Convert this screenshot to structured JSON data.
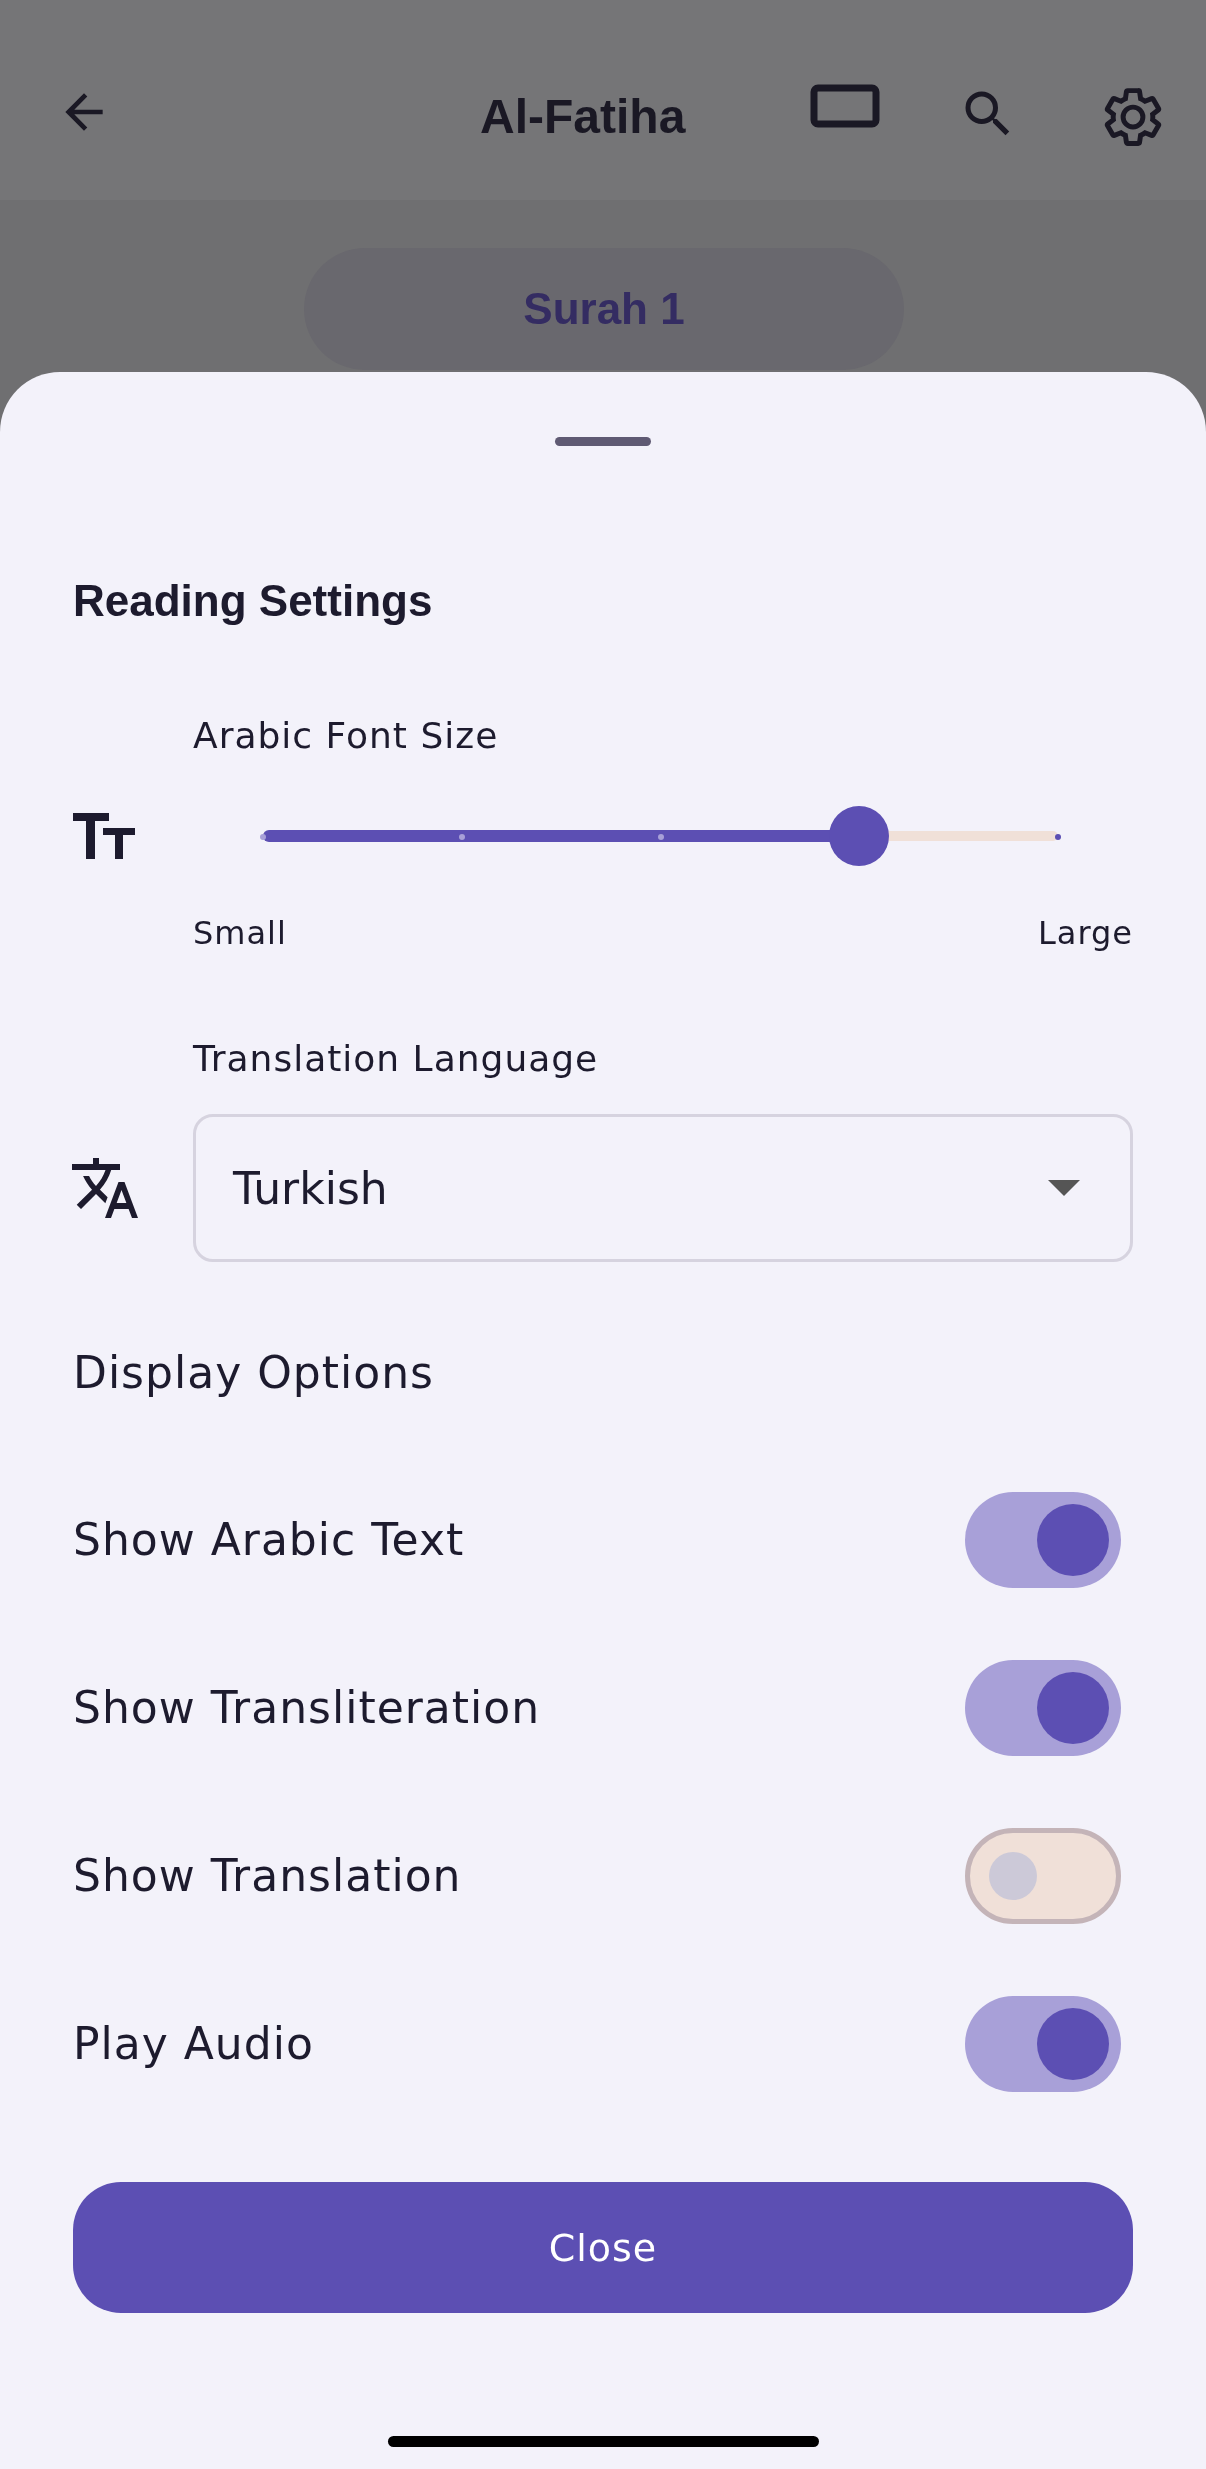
{
  "app_bar": {
    "title": "Al-Fatiha"
  },
  "chip": {
    "label": "Surah 1"
  },
  "sheet": {
    "title": "Reading Settings",
    "font_size": {
      "label": "Arabic Font Size",
      "level": 0.75,
      "min_label": "Small",
      "max_label": "Large"
    },
    "translation": {
      "label": "Translation Language",
      "value": "Turkish"
    },
    "display_section": "Display Options",
    "options": [
      {
        "label": "Show Arabic Text",
        "on": true
      },
      {
        "label": "Show Transliteration",
        "on": true
      },
      {
        "label": "Show Translation",
        "on": false
      },
      {
        "label": "Play Audio",
        "on": true
      }
    ],
    "close_button": "Close"
  }
}
